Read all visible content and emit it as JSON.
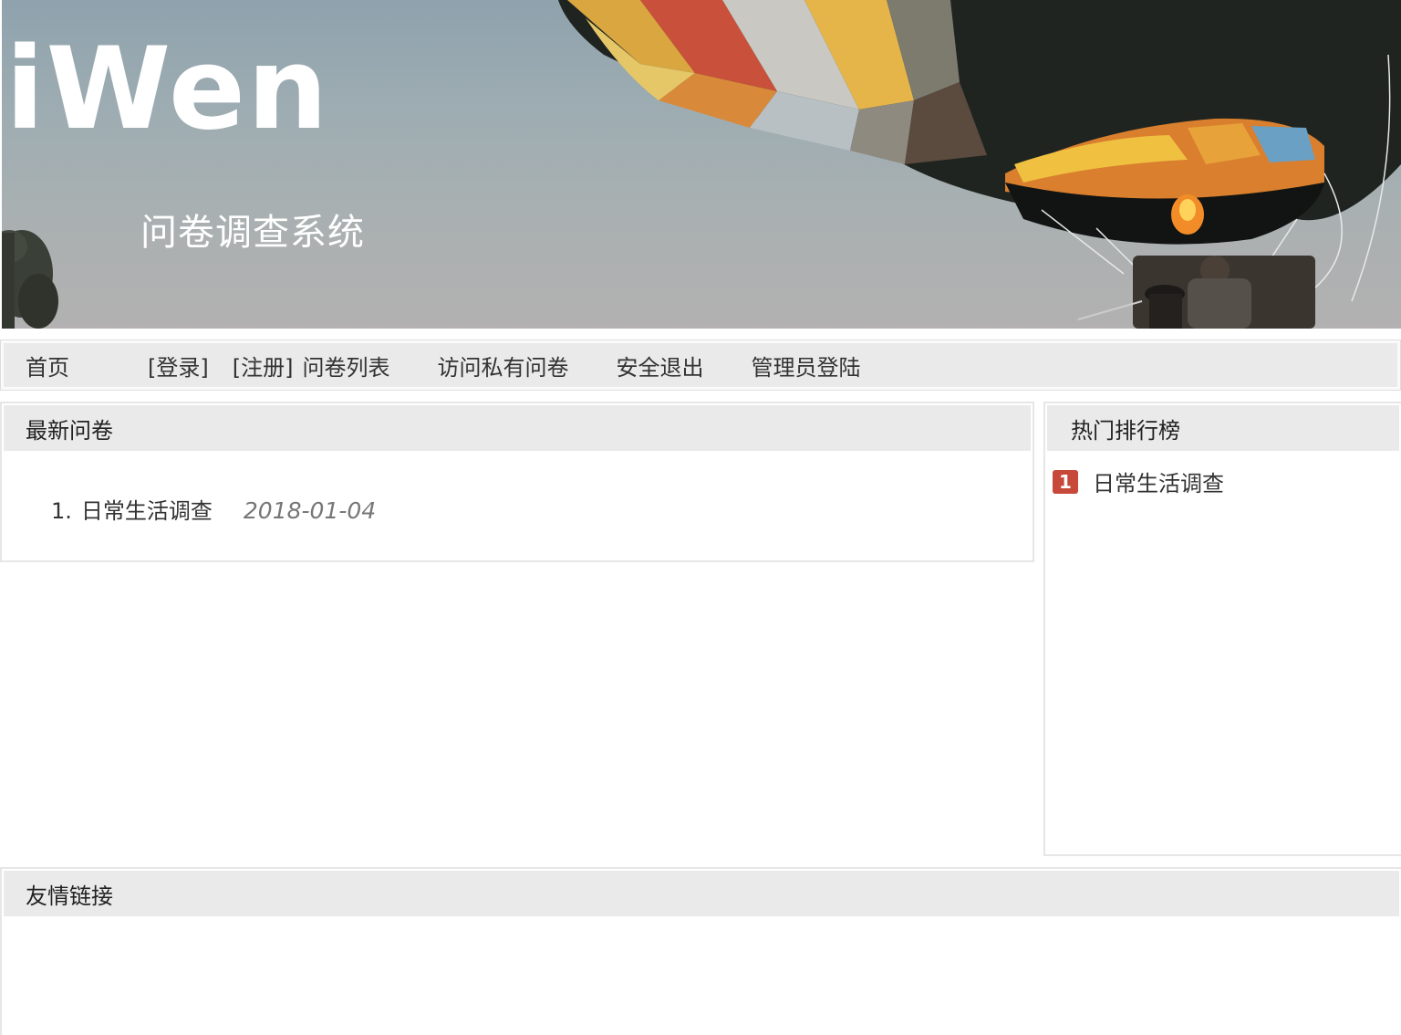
{
  "banner": {
    "logo": "iWen",
    "subtitle": "问卷调查系统"
  },
  "nav": {
    "home": "首页",
    "login": "[登录]",
    "register": "[注册]",
    "survey_list": "问卷列表",
    "private_survey": "访问私有问卷",
    "logout": "安全退出",
    "admin_login": "管理员登陆"
  },
  "latest": {
    "title": "最新问卷",
    "items": [
      {
        "index": "1.",
        "title": "日常生活调查",
        "date": "2018-01-04"
      }
    ]
  },
  "hot": {
    "title": "热门排行榜",
    "items": [
      {
        "rank": "1",
        "title": "日常生活调查"
      }
    ]
  },
  "links": {
    "title": "友情链接"
  },
  "colors": {
    "header_bg": "#eaeaea",
    "rank_badge": "#c6493a",
    "text": "#333333",
    "date": "#777777"
  }
}
